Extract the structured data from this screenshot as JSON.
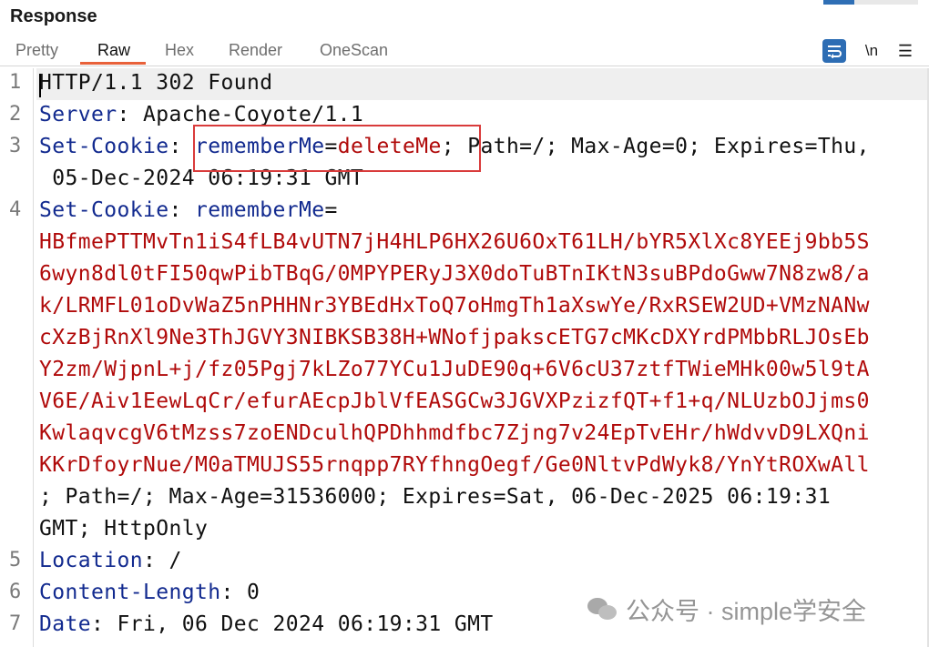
{
  "panel": {
    "title": "Response"
  },
  "tabs": [
    {
      "label": "Pretty",
      "active": false
    },
    {
      "label": "Raw",
      "active": true
    },
    {
      "label": "Hex",
      "active": false
    },
    {
      "label": "Render",
      "active": false
    },
    {
      "label": "OneScan",
      "active": false
    }
  ],
  "toolbar": {
    "wrap_icon": "word-wrap-icon",
    "newline_label": "\\n",
    "menu_icon": "hamburger-menu-icon"
  },
  "lines": [
    {
      "num": "1",
      "rows": [
        {
          "segments": [
            {
              "t": "HTTP/1.1 302 Found",
              "c": "plain"
            }
          ]
        }
      ]
    },
    {
      "num": "2",
      "rows": [
        {
          "segments": [
            {
              "t": "Server",
              "c": "key"
            },
            {
              "t": ": Apache-Coyote/1.1",
              "c": "plain"
            }
          ]
        }
      ]
    },
    {
      "num": "3",
      "rows": [
        {
          "segments": [
            {
              "t": "Set-Cookie",
              "c": "key"
            },
            {
              "t": ": ",
              "c": "plain"
            },
            {
              "t": "rememberMe",
              "c": "key"
            },
            {
              "t": "=",
              "c": "plain"
            },
            {
              "t": "deleteMe",
              "c": "val"
            },
            {
              "t": "; Path=/; Max-Age=0; Expires=Thu,",
              "c": "plain"
            }
          ]
        },
        {
          "segments": [
            {
              "t": " 05-Dec-2024 06:19:31 GMT",
              "c": "plain"
            }
          ]
        }
      ]
    },
    {
      "num": "4",
      "rows": [
        {
          "segments": [
            {
              "t": "Set-Cookie",
              "c": "key"
            },
            {
              "t": ": ",
              "c": "plain"
            },
            {
              "t": "rememberMe",
              "c": "key"
            },
            {
              "t": "=",
              "c": "plain"
            }
          ]
        },
        {
          "segments": [
            {
              "t": "HBfmePTTMvTn1iS4fLB4vUTN7jH4HLP6HX26U6OxT61LH/bYR5XlXc8YEEj9bb5S",
              "c": "val"
            }
          ]
        },
        {
          "segments": [
            {
              "t": "6wyn8dl0tFI50qwPibTBqG/0MPYPERyJ3X0doTuBTnIKtN3suBPdoGww7N8zw8/a",
              "c": "val"
            }
          ]
        },
        {
          "segments": [
            {
              "t": "k/LRMFL01oDvWaZ5nPHHNr3YBEdHxToQ7oHmgTh1aXswYe/RxRSEW2UD+VMzNANw",
              "c": "val"
            }
          ]
        },
        {
          "segments": [
            {
              "t": "cXzBjRnXl9Ne3ThJGVY3NIBKSB38H+WNofjpakscETG7cMKcDXYrdPMbbRLJOsEb",
              "c": "val"
            }
          ]
        },
        {
          "segments": [
            {
              "t": "Y2zm/WjpnL+j/fz05Pgj7kLZo77YCu1JuDE90q+6V6cU37ztfTWieMHk00w5l9tA",
              "c": "val"
            }
          ]
        },
        {
          "segments": [
            {
              "t": "V6E/Aiv1EewLqCr/efurAEcpJblVfEASGCw3JGVXPzizfQT+f1+q/NLUzbOJjms0",
              "c": "val"
            }
          ]
        },
        {
          "segments": [
            {
              "t": "KwlaqvcgV6tMzss7zoENDculhQPDhhmdfbc7Zjng7v24EpTvEHr/hWdvvD9LXQni",
              "c": "val"
            }
          ]
        },
        {
          "segments": [
            {
              "t": "KKrDfoyrNue/M0aTMUJS55rnqpp7RYfhngOegf/Ge0NltvPdWyk8/YnYtROXwAll",
              "c": "val"
            }
          ]
        },
        {
          "segments": [
            {
              "t": "; Path=/; Max-Age=31536000; Expires=Sat, 06-Dec-2025 06:19:31",
              "c": "plain"
            }
          ]
        },
        {
          "segments": [
            {
              "t": "GMT; HttpOnly",
              "c": "plain"
            }
          ]
        }
      ]
    },
    {
      "num": "5",
      "rows": [
        {
          "segments": [
            {
              "t": "Location",
              "c": "key"
            },
            {
              "t": ": /",
              "c": "plain"
            }
          ]
        }
      ]
    },
    {
      "num": "6",
      "rows": [
        {
          "segments": [
            {
              "t": "Content-Length",
              "c": "key"
            },
            {
              "t": ": 0",
              "c": "plain"
            }
          ]
        }
      ]
    },
    {
      "num": "7",
      "rows": [
        {
          "segments": [
            {
              "t": "Date",
              "c": "key"
            },
            {
              "t": ": Fri, 06 Dec 2024 06:19:31 GMT",
              "c": "plain"
            }
          ]
        }
      ]
    }
  ],
  "watermark": {
    "text": "公众号 · simple学安全",
    "icon": "wechat-icon"
  },
  "colors": {
    "key": "#122a8f",
    "value": "#b00a0a",
    "accent": "#e8613a",
    "highlight_box": "#d93b3b"
  }
}
